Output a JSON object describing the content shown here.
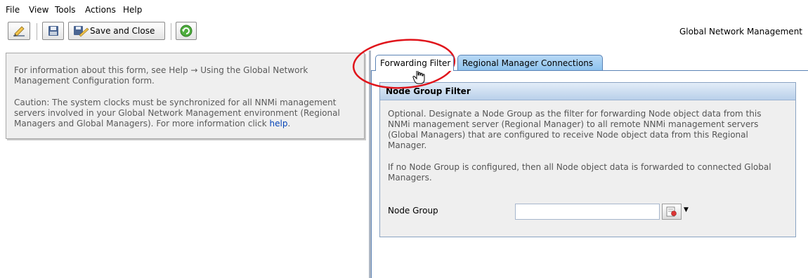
{
  "menu": {
    "items": [
      "File",
      "View",
      "Tools",
      "Actions",
      "Help"
    ]
  },
  "toolbar": {
    "save_close_label": "Save and Close",
    "app_title": "Global Network Management",
    "icons": [
      "edit-icon",
      "save-icon",
      "save-and-close-icon",
      "refresh-icon"
    ]
  },
  "info": {
    "line1": "For information about this form, see Help → Using the Global Network",
    "line2": "Management Configuration form.",
    "caution1": "Caution: The system clocks must be synchronized for all NNMi management",
    "caution2": "servers involved in your Global Network Management environment (Regional",
    "caution3_prefix": "Managers and Global Managers). For more information click",
    "caution3_link": "help",
    "caution3_suffix": "."
  },
  "tabs": {
    "active": "Forwarding Filter",
    "inactive": "Regional Manager Connections"
  },
  "section": {
    "title": "Node Group Filter",
    "p1_l1": "Optional. Designate a Node Group as the filter for forwarding Node object data from this",
    "p1_l2": "NNMi management server (Regional Manager) to all remote NNMi management servers",
    "p1_l3": "(Global Managers) that are configured to receive Node object data from this Regional",
    "p1_l4": "Manager.",
    "p2_l1": "If no Node Group is configured, then all Node object data is forwarded to connected Global",
    "p2_l2": "Managers.",
    "field_label": "Node Group",
    "field_value": ""
  },
  "colors": {
    "accent": "#5b83b5",
    "annotation": "#e0141b",
    "link": "#0645b8"
  }
}
